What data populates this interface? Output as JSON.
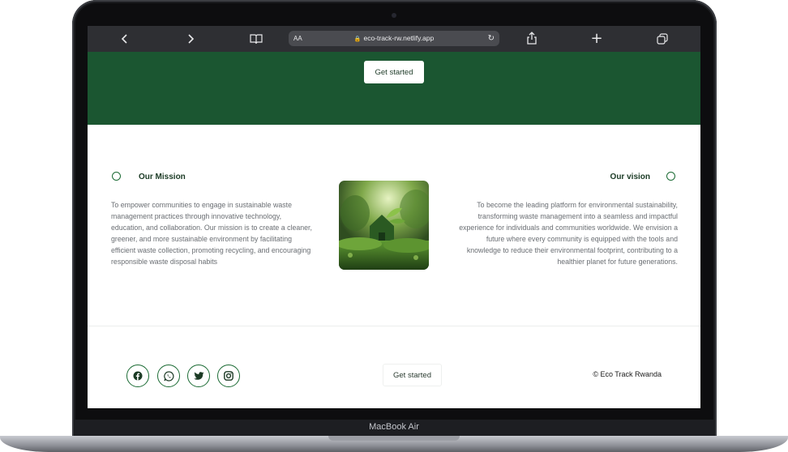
{
  "device": {
    "model_label": "MacBook Air"
  },
  "browser": {
    "text_size_label": "AA",
    "url": "eco-track-rw.netlify.app",
    "icons": [
      "back-icon",
      "forward-icon",
      "bookmarks-icon",
      "lock-icon",
      "reload-icon",
      "share-icon",
      "new-tab-icon",
      "tabs-icon"
    ]
  },
  "hero": {
    "cta_label": "Get started",
    "background_color": "#1b5631"
  },
  "mission": {
    "title": "Our Mission",
    "text": "To empower communities to engage in sustainable waste management practices through innovative technology, education, and collaboration. Our mission is to create a cleaner, greener, and more sustainable environment by facilitating efficient waste collection, promoting recycling, and encouraging responsible waste disposal habits"
  },
  "vision": {
    "title": "Our vision",
    "text": "To become the leading platform for environmental sustainability, transforming waste management into a seamless and impactful experience for individuals and communities worldwide. We envision a future where every community is equipped with the tools and knowledge to reduce their environmental footprint, contributing to a healthier planet for future generations."
  },
  "image": {
    "subject": "green house shape among plants"
  },
  "footer": {
    "social_icons": [
      "facebook-icon",
      "whatsapp-icon",
      "twitter-icon",
      "instagram-icon"
    ],
    "cta_label": "Get started",
    "copyright": "© Eco Track Rwanda"
  },
  "colors": {
    "accent": "#1b6b34",
    "hero": "#1b5631",
    "text_muted": "#6a6e73",
    "heading": "#1a3a24"
  }
}
